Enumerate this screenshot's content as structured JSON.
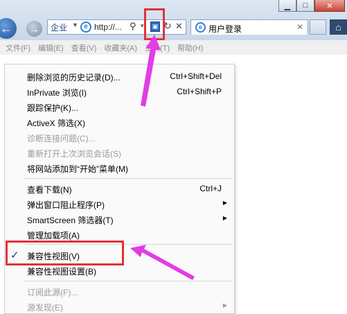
{
  "window": {
    "minimize_icon": "minimize-icon",
    "maximize_icon": "maximize-icon",
    "close_icon": "close-icon"
  },
  "address_bar": {
    "zone_label": "企业",
    "url_text": "http://...",
    "compat_icon": "compatibility-view-icon"
  },
  "tab": {
    "title": "用户登录",
    "close_glyph": "✕"
  },
  "menubar": {
    "items": [
      "文件(F)",
      "编辑(E)",
      "查看(V)",
      "收藏夹(A)",
      "工具(T)",
      "帮助(H)"
    ]
  },
  "tools_menu": {
    "items": [
      {
        "label": "删除浏览的历史记录(D)...",
        "shortcut": "Ctrl+Shift+Del"
      },
      {
        "label": "InPrivate 浏览(I)",
        "shortcut": "Ctrl+Shift+P"
      },
      {
        "label": "跟踪保护(K)..."
      },
      {
        "label": "ActiveX 筛选(X)"
      },
      {
        "label": "诊断连接问题(C)...",
        "disabled": true
      },
      {
        "label": "重新打开上次浏览会话(S)",
        "disabled": true
      },
      {
        "label": "将网站添加到“开始”菜单(M)"
      },
      {
        "label": "查看下载(N)",
        "shortcut": "Ctrl+J"
      },
      {
        "label": "弹出窗口阻止程序(P)",
        "submenu": true
      },
      {
        "label": "SmartScreen 筛选器(T)",
        "submenu": true
      },
      {
        "label": "管理加载项(A)"
      },
      {
        "label": "兼容性视图(V)",
        "checked": true,
        "check_glyph": "✓"
      },
      {
        "label": "兼容性视图设置(B)"
      },
      {
        "label": "订阅此源(F)...",
        "disabled": true
      },
      {
        "label": "源发现(E)",
        "disabled": true,
        "submenu": true
      }
    ]
  },
  "annotation_color": "#e0323a",
  "arrow_color": "#e33ce6"
}
